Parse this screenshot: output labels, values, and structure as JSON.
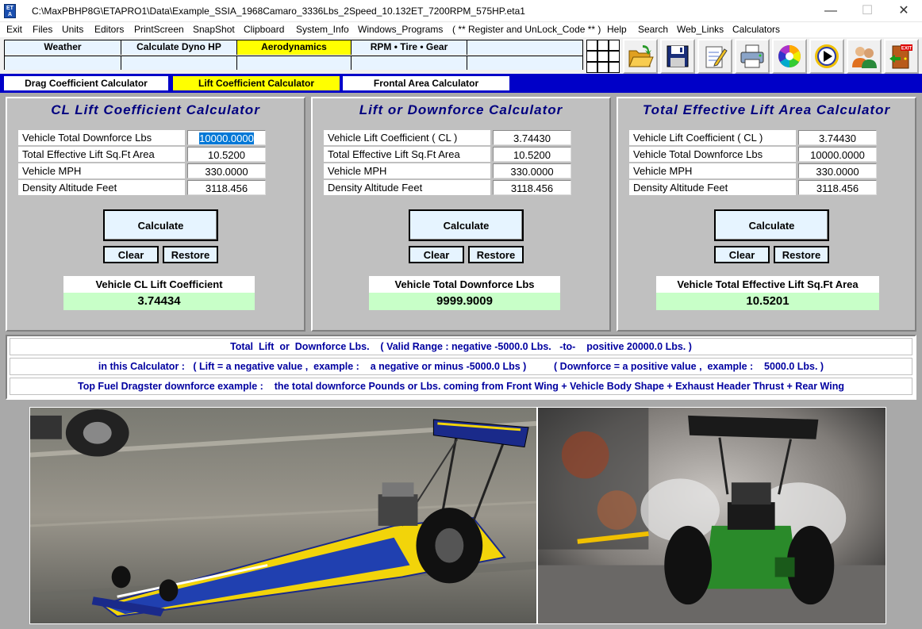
{
  "window": {
    "icon_text": "ET A",
    "title": "C:\\MaxPBHP8G\\ETAPRO1\\Data\\Example_SSIA_1968Camaro_3336Lbs_2Speed_10.132ET_7200RPM_575HP.eta1",
    "minimize": "—",
    "maximize": "☐",
    "close": "✕"
  },
  "menu": [
    "Exit",
    "Files",
    "Units",
    "Editors",
    "PrintScreen",
    "SnapShot",
    "Clipboard",
    "System_Info",
    "Windows_Programs",
    "( ** Register and UnLock_Code ** )",
    "Help",
    "Search",
    "Web_Links",
    "Calculators"
  ],
  "top_tabs": [
    "Weather",
    "Calculate Dyno HP",
    "Aerodynamics",
    "RPM  •  Tire  •  Gear",
    ""
  ],
  "toolbar_icons": [
    "folder-open-icon",
    "save-disk-icon",
    "notepad-edit-icon",
    "printer-icon",
    "color-wheel-icon",
    "play-media-icon",
    "users-icon",
    "exit-door-icon"
  ],
  "toolbar_exit_label": "EXIT",
  "sub_tabs": [
    "Drag Coefficient Calculator",
    "Lift Coefficient Calculator",
    "Frontal Area Calculator"
  ],
  "panels": [
    {
      "title": "CL  Lift  Coefficient  Calculator",
      "rows": [
        {
          "label": "Vehicle Total Downforce Lbs",
          "value": "10000.0000"
        },
        {
          "label": "Total Effective Lift Sq.Ft Area",
          "value": "10.5200"
        },
        {
          "label": "Vehicle MPH",
          "value": "330.0000"
        },
        {
          "label": "Density Altitude Feet",
          "value": "3118.456"
        }
      ],
      "calculate": "Calculate",
      "clear": "Clear",
      "restore": "Restore",
      "result_label": "Vehicle  CL  Lift  Coefficient",
      "result_value": "3.74434"
    },
    {
      "title": "Lift  or  Downforce  Calculator",
      "rows": [
        {
          "label": "Vehicle Lift Coefficient   ( CL )",
          "value": "3.74430"
        },
        {
          "label": "Total Effective Lift Sq.Ft Area",
          "value": "10.5200"
        },
        {
          "label": "Vehicle MPH",
          "value": "330.0000"
        },
        {
          "label": "Density Altitude Feet",
          "value": "3118.456"
        }
      ],
      "calculate": "Calculate",
      "clear": "Clear",
      "restore": "Restore",
      "result_label": "Vehicle Total Downforce Lbs",
      "result_value": "9999.9009"
    },
    {
      "title": "Total  Effective  Lift  Area  Calculator",
      "rows": [
        {
          "label": "Vehicle Lift Coefficient   ( CL )",
          "value": "3.74430"
        },
        {
          "label": "Vehicle Total Downforce Lbs",
          "value": "10000.0000"
        },
        {
          "label": "Vehicle MPH",
          "value": "330.0000"
        },
        {
          "label": "Density Altitude Feet",
          "value": "3118.456"
        }
      ],
      "calculate": "Calculate",
      "clear": "Clear",
      "restore": "Restore",
      "result_label": "Vehicle Total Effective Lift Sq.Ft Area",
      "result_value": "10.5201"
    }
  ],
  "info_lines": [
    "Total  Lift  or  Downforce Lbs.    ( Valid Range : negative -5000.0 Lbs.   -to-    positive 20000.0 Lbs. )",
    "in this Calculator :   ( Lift = a negative value ,  example :    a negative or minus -5000.0 Lbs )          ( Downforce = a positive value ,  example :    5000.0 Lbs. )",
    "Top Fuel Dragster downforce example :    the total downforce Pounds or Lbs. coming from Front Wing + Vehicle Body Shape + Exhaust Header Thrust + Rear Wing"
  ],
  "colors": {
    "title_blue": "#000080",
    "info_blue": "#0000a0",
    "subtab_bar": "#0000c8",
    "active_tab": "#ffff00",
    "result_green": "#c8ffc8",
    "button_face": "#e6f4ff",
    "panel_gray": "#c0c0c0"
  }
}
